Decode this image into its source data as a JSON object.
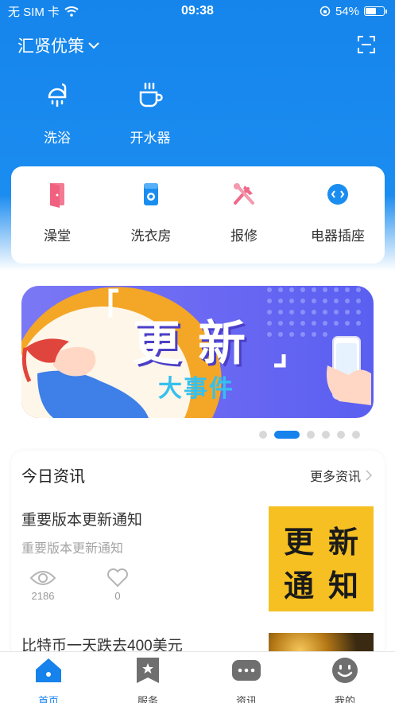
{
  "status": {
    "carrier": "无 SIM 卡",
    "time": "09:38",
    "battery": "54%"
  },
  "header": {
    "campus": "汇贤优策"
  },
  "quick": [
    {
      "label": "洗浴"
    },
    {
      "label": "开水器"
    }
  ],
  "services": [
    {
      "label": "澡堂"
    },
    {
      "label": "洗衣房"
    },
    {
      "label": "报修"
    },
    {
      "label": "电器插座"
    }
  ],
  "banner": {
    "title": "更新",
    "subtitle": "大事件"
  },
  "carousel": {
    "active_index": 1,
    "count": 6
  },
  "news": {
    "heading": "今日资讯",
    "more": "更多资讯",
    "items": [
      {
        "title": "重要版本更新通知",
        "subtitle": "重要版本更新通知",
        "views": "2186",
        "likes": "0",
        "thumb": [
          "更",
          "新",
          "通",
          "知"
        ]
      },
      {
        "title": "比特币一天跌去400美元"
      }
    ]
  },
  "tabs": [
    {
      "label": "首页"
    },
    {
      "label": "服务"
    },
    {
      "label": "资讯"
    },
    {
      "label": "我的"
    }
  ],
  "colors": {
    "primary": "#1682ec",
    "card": "#ffffff",
    "thumb_yellow": "#f6c022",
    "repair_pink": "#f06a8a"
  }
}
